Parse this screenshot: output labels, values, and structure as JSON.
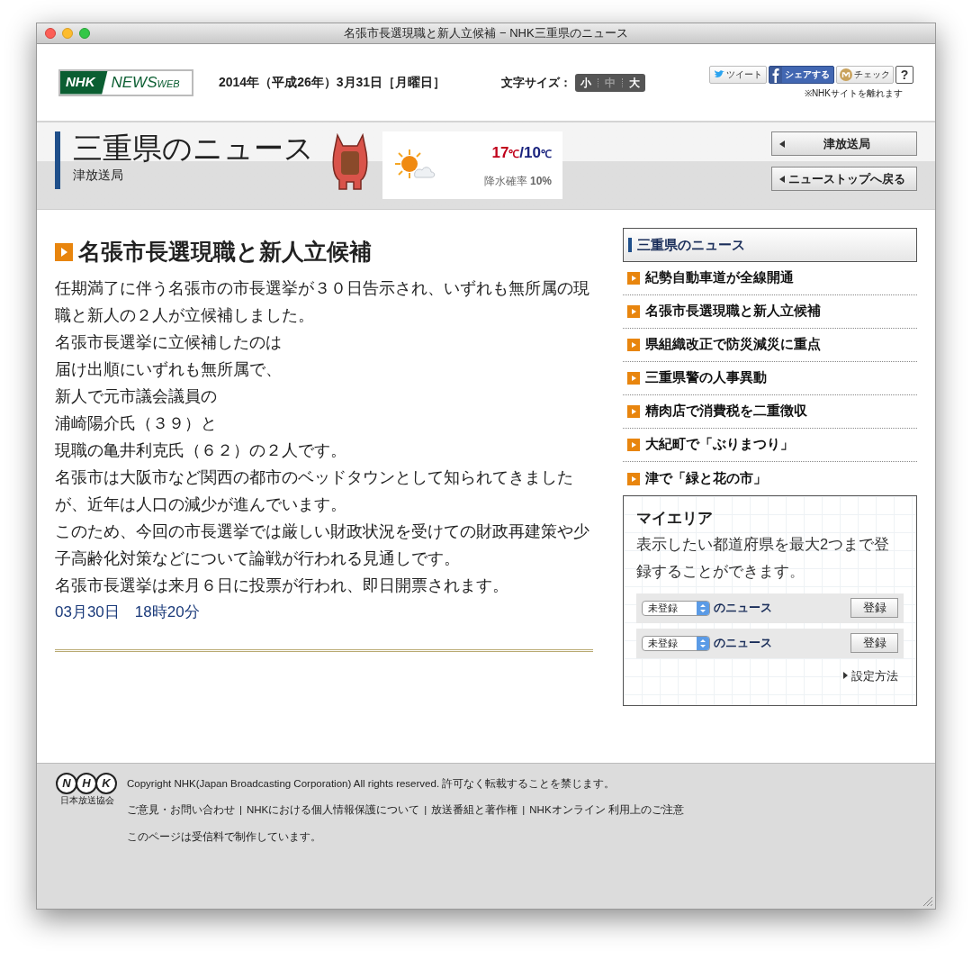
{
  "window": {
    "title": "名張市長選現職と新人立候補 − NHK三重県のニュース"
  },
  "header": {
    "logo": {
      "nhk": "NHK",
      "news": "NEWS",
      "web": "WEB"
    },
    "date": "2014年（平成26年）3月31日［月曜日］",
    "text_size": {
      "label": "文字サイズ：",
      "options": [
        {
          "label": "小",
          "selected": false
        },
        {
          "label": "中",
          "selected": true
        },
        {
          "label": "大",
          "selected": false
        }
      ]
    },
    "social": {
      "tweet": "ツイート",
      "share": "シェアする",
      "check": "チェック",
      "help": "?",
      "note": "※NHKサイトを離れます"
    }
  },
  "band": {
    "title": "三重県のニュース",
    "subtitle": "津放送局",
    "weather": {
      "high": "17",
      "low": "10",
      "unit": "℃",
      "separator": "/",
      "rain_label": "降水確率",
      "rain": "10%"
    },
    "buttons": [
      "津放送局",
      "ニューストップへ戻る"
    ]
  },
  "article": {
    "title": "名張市長選現職と新人立候補",
    "paragraphs": [
      "任期満了に伴う名張市の市長選挙が３０日告示され、いずれも無所属の現職と新人の２人が立候補しました。",
      "名張市長選挙に立候補したのは",
      "届け出順にいずれも無所属で、",
      "新人で元市議会議員の",
      "浦崎陽介氏（３９）と",
      "現職の亀井利克氏（６２）の２人です。",
      "名張市は大阪市など関西の都市のベッドタウンとして知られてきましたが、近年は人口の減少が進んでいます。",
      "このため、今回の市長選挙では厳しい財政状況を受けての財政再建策や少子高齢化対策などについて論戦が行われる見通しです。",
      "名張市長選挙は来月６日に投票が行われ、即日開票されます。"
    ],
    "timestamp": "03月30日　18時20分"
  },
  "sidebar": {
    "heading": "三重県のニュース",
    "items": [
      "紀勢自動車道が全線開通",
      "名張市長選現職と新人立候補",
      "県組織改正で防災減災に重点",
      "三重県警の人事異動",
      "精肉店で消費税を二重徴収",
      "大紀町で「ぶりまつり」",
      "津で「緑と花の市」"
    ],
    "my_area": {
      "title": "マイエリア",
      "description": "表示したい都道府県を最大2つまで登録することができます。",
      "rows": [
        {
          "select": "未登録",
          "suffix": "のニュース",
          "button": "登録"
        },
        {
          "select": "未登録",
          "suffix": "のニュース",
          "button": "登録"
        }
      ],
      "link": "設定方法"
    }
  },
  "footer": {
    "logo": {
      "letters": [
        "N",
        "H",
        "K"
      ],
      "caption": "日本放送協会"
    },
    "copyright": "Copyright NHK(Japan Broadcasting Corporation) All rights reserved. 許可なく転載することを禁じます。",
    "links": [
      "ご意見・お問い合わせ",
      "NHKにおける個人情報保護について",
      "放送番組と著作権",
      "NHKオンライン 利用上のご注意"
    ],
    "separator": "|",
    "note": "このページは受信料で制作しています。"
  }
}
